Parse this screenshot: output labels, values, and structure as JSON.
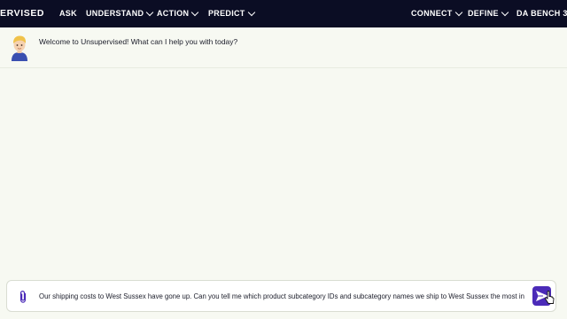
{
  "nav": {
    "brand": "ERVISED",
    "left": [
      {
        "label": "ASK",
        "chevron": false
      },
      {
        "label": "UNDERSTAND",
        "chevron": true
      },
      {
        "label": "ACTION",
        "chevron": true
      },
      {
        "label": "PREDICT",
        "chevron": true
      }
    ],
    "right": [
      {
        "label": "CONNECT",
        "chevron": true
      },
      {
        "label": "DEFINE",
        "chevron": true
      },
      {
        "label": "DA BENCH 3",
        "chevron": false
      }
    ]
  },
  "chat": {
    "assistant_message": "Welcome to Unsupervised! What can I help you with today?"
  },
  "composer": {
    "value": "Our shipping costs to West Sussex have gone up. Can you tell me which product subcategory IDs and subcategory names we ship to West Sussex the most in",
    "send_icon": "send-icon",
    "attach_icon": "paperclip-icon"
  },
  "colors": {
    "topbar": "#0b0d24",
    "background": "#f7f9f2",
    "send_button": "#4b2bb8"
  }
}
